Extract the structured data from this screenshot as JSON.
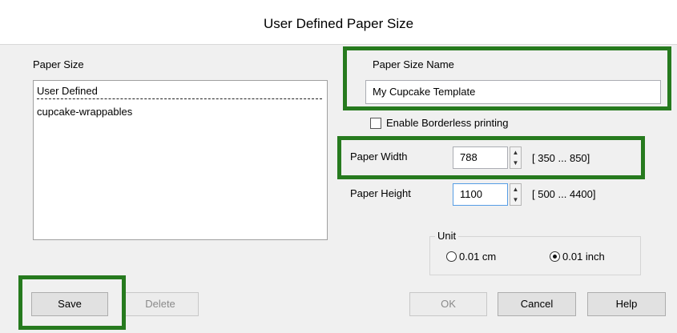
{
  "dialog": {
    "title": "User Defined Paper Size"
  },
  "paper_size": {
    "label": "Paper Size",
    "items": [
      {
        "label": "User Defined",
        "selected": true
      },
      {
        "label": "cupcake-wrappables",
        "selected": false
      }
    ]
  },
  "paper_size_name": {
    "label": "Paper Size Name",
    "value": "My Cupcake Template"
  },
  "borderless": {
    "label": "Enable Borderless printing",
    "checked": false
  },
  "paper_width": {
    "label": "Paper Width",
    "value": "788",
    "range": "[ 350 ...  850]"
  },
  "paper_height": {
    "label": "Paper Height",
    "value": "1100",
    "range": "[ 500 ... 4400]"
  },
  "unit": {
    "label": "Unit",
    "options": [
      {
        "label": "0.01 cm",
        "selected": false
      },
      {
        "label": "0.01 inch",
        "selected": true
      }
    ]
  },
  "buttons": {
    "save": "Save",
    "delete": "Delete",
    "ok": "OK",
    "cancel": "Cancel",
    "help": "Help"
  },
  "colors": {
    "highlight": "#267a1e"
  }
}
